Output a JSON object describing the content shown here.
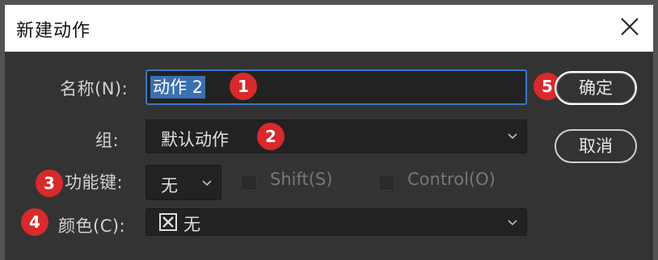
{
  "dialog": {
    "title": "新建动作"
  },
  "form": {
    "name_label": "名称(N):",
    "name_value": "动作 2",
    "group_label": "组:",
    "group_value": "默认动作",
    "function_key_label": "功能键:",
    "function_key_value": "无",
    "shift_label": "Shift(S)",
    "control_label": "Control(O)",
    "color_label": "颜色(C):",
    "color_value": "无"
  },
  "buttons": {
    "ok_label": "确定",
    "cancel_label": "取消"
  },
  "annotations": {
    "b1": "1",
    "b2": "2",
    "b3": "3",
    "b4": "4",
    "b5": "5"
  },
  "colors": {
    "annotation_badge": "#d8292b",
    "focus_border": "#3b78c6",
    "selection": "#3a6fb0"
  }
}
